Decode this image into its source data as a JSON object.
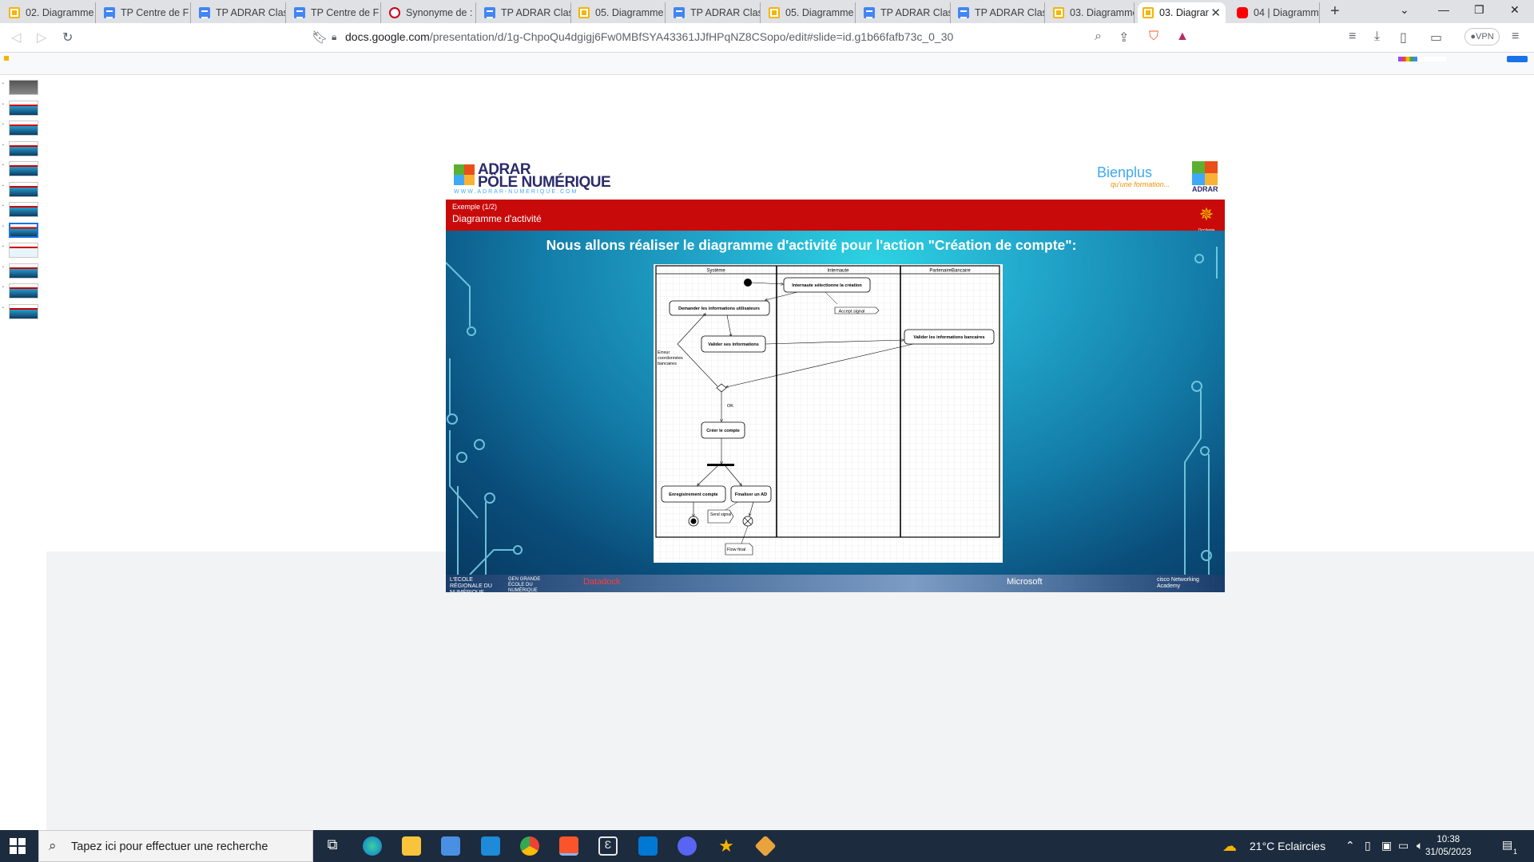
{
  "browser": {
    "tabs": [
      {
        "title": "02. Diagramme",
        "icon": "slides"
      },
      {
        "title": "TP Centre de F",
        "icon": "docs"
      },
      {
        "title": "TP ADRAR Clas",
        "icon": "docs"
      },
      {
        "title": "TP Centre de F",
        "icon": "docs"
      },
      {
        "title": "Synonyme de :",
        "icon": "synonyme"
      },
      {
        "title": "TP ADRAR Clas",
        "icon": "docs"
      },
      {
        "title": "05. Diagramme",
        "icon": "slides"
      },
      {
        "title": "TP ADRAR Clas",
        "icon": "docs"
      },
      {
        "title": "05. Diagramme",
        "icon": "slides"
      },
      {
        "title": "TP ADRAR Clas",
        "icon": "docs"
      },
      {
        "title": "TP ADRAR Clas",
        "icon": "docs"
      },
      {
        "title": "03. Diagramme",
        "icon": "slides"
      },
      {
        "title": "03. Diagrar",
        "icon": "slides"
      },
      {
        "title": "04 | Diagramm",
        "icon": "youtube"
      }
    ],
    "active_tab_index": 12,
    "url_host": "docs.google.com",
    "url_path": "/presentation/d/1g-ChpoQu4dgigj6Fw0MBfSYA43361JJfHPqNZ8CSopo/edit#slide=id.g1b66fafb73c_0_30",
    "vpn_label": "VPN"
  },
  "slides": {
    "thumb_count": 12,
    "selected_index": 7
  },
  "slide": {
    "logo_line1": "ADRAR",
    "logo_line2": "PÔLE NUMÉRIQUE",
    "logo_url": "WWW.ADRAR-NUMERIQUE.COM",
    "bienplus": "Bienplus",
    "bienplus_sub": "qu'une formation...",
    "adrar_label": "ADRAR",
    "occitanie_label": "Occitanie",
    "subtitle": "Exemple (1/2)",
    "title": "Diagramme d'activité",
    "heading": "Nous allons réaliser le diagramme d'activité pour l'action \"Création de compte\":",
    "footer_logos": [
      "L'ECOLE RÉGIONALE DU NUMÉRIQUE",
      "GEN GRANDE ÉCOLE DU NUMÉRIQUE",
      "Datadock",
      "Microsoft",
      "cisco Networking Academy"
    ]
  },
  "diagram": {
    "lanes": [
      "Système",
      "Internaute",
      "PartenaireBancaire"
    ],
    "actions": {
      "select": "Internaute sélectionne la création",
      "ask": "Demander les informations utilisateurs",
      "validate": "Valider ses informations",
      "bank": "Valider les informations bancaires",
      "create": "Créer le compte",
      "register": "Enregistrement compte",
      "finalize": "Finaliser un AD"
    },
    "signals": {
      "accept": "Accept signal",
      "send": "Send signal",
      "flow_final": "Flow final"
    },
    "guards": {
      "error": [
        "Erreur",
        "coordonnées",
        "bancaires"
      ],
      "ok": "OK"
    }
  },
  "taskbar": {
    "search_placeholder": "Tapez ici pour effectuer une recherche",
    "weather": "21°C  Eclaircies",
    "time": "10:38",
    "date": "31/05/2023",
    "notif_count": "1"
  },
  "colors": {
    "red_band": "#c90a0a",
    "slide_blue": "#137ca8",
    "taskbar": "#1c2b3d"
  }
}
